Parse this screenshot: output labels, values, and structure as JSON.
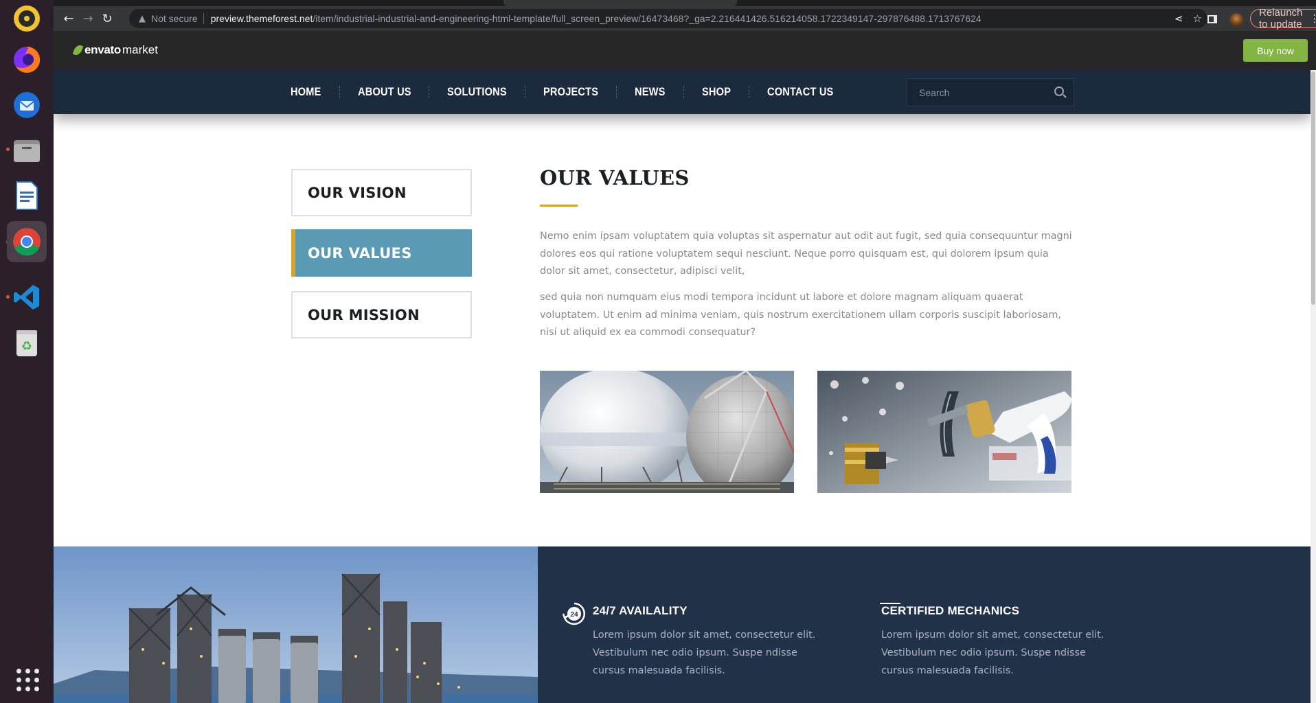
{
  "browser": {
    "security_label": "Not secure",
    "url_host": "preview.themeforest.net",
    "url_path": "/item/industrial-industrial-and-engineering-html-template/full_screen_preview/16473468?_ga=2.216441426.516214058.1722349147-297876488.1713767624",
    "relaunch_label": "Relaunch to update"
  },
  "envato": {
    "logo_bold": "envato",
    "logo_light": "market",
    "buy_label": "Buy now"
  },
  "nav": {
    "items": [
      "HOME",
      "ABOUT US",
      "SOLUTIONS",
      "PROJECTS",
      "NEWS",
      "SHOP",
      "CONTACT US"
    ],
    "search_placeholder": "Search"
  },
  "tabs": {
    "vision": "OUR VISION",
    "values": "OUR VALUES",
    "mission": "OUR MISSION"
  },
  "content": {
    "title": "OUR VALUES",
    "para1": "Nemo enim ipsam voluptatem quia voluptas sit aspernatur aut odit aut fugit, sed quia consequuntur magni dolores eos qui ratione voluptatem sequi nesciunt. Neque porro quisquam est, qui dolorem ipsum quia dolor sit amet, consectetur, adipisci velit,",
    "para2": "sed quia non numquam eius modi tempora incidunt ut labore et dolore magnam aliquam quaerat voluptatem. Ut enim ad minima veniam, quis nostrum exercitationem ullam corporis suscipit laboriosam, nisi ut aliquid ex ea commodi consequatur?"
  },
  "features": [
    {
      "icon": "24-hours-icon",
      "title": "24/7 AVAILALITY",
      "text": "Lorem ipsum dolor sit amet, consectetur elit. Vestibulum nec odio ipsum. Suspe ndisse cursus malesuada facilisis."
    },
    {
      "icon": "certificate-icon",
      "title": "CERTIFIED MECHANICS",
      "text": "Lorem ipsum dolor sit amet, consectetur elit. Vestibulum nec odio ipsum. Suspe ndisse cursus malesuada facilisis."
    }
  ],
  "colors": {
    "nav_bg": "#1b2a3d",
    "active_tab": "#5a9ab5",
    "accent_gold": "#d9a32a",
    "feature_bg": "#213248",
    "envato_green": "#82b541"
  }
}
